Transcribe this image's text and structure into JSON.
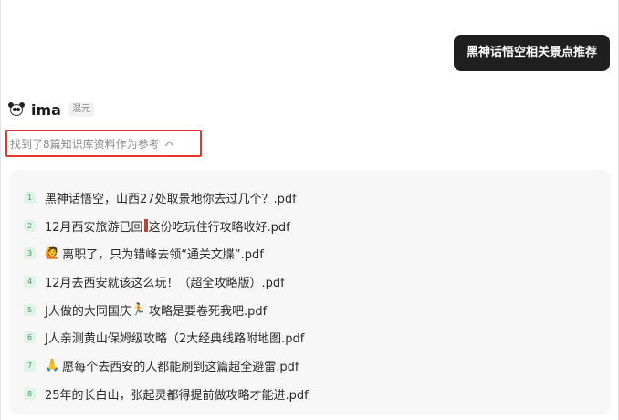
{
  "user_message": "黑神话悟空相关景点推荐",
  "assistant": {
    "avatar_icon": "panda-icon",
    "name": "ima",
    "model_tag": "混元"
  },
  "references": {
    "toggle_label": "找到了8篇知识库资料作为参考",
    "highlight_color": "#e8352b",
    "items": [
      {
        "num": "1",
        "title": "黑神话悟空，山西27处取景地你去过几个？.pdf"
      },
      {
        "num": "2",
        "title_a": "12月西安旅游已回",
        "title_b": "这份吃玩住行攻略收好.pdf"
      },
      {
        "num": "3",
        "icon": "🙋",
        "title": "离职了，只为错峰去领“通关文牒”.pdf"
      },
      {
        "num": "4",
        "title": "12月去西安就该这么玩！（超全攻略版）.pdf"
      },
      {
        "num": "5",
        "title_a": "J人做的大同国庆",
        "icon": "🏃",
        "title_b": "攻略是要卷死我吧.pdf"
      },
      {
        "num": "6",
        "title": "J人亲测黄山保姆级攻略（2大经典线路附地图.pdf"
      },
      {
        "num": "7",
        "icon": "🙏",
        "title": "愿每个去西安的人都能刷到这篇超全避雷.pdf"
      },
      {
        "num": "8",
        "title": "25年的长白山，张起灵都得提前做攻略才能进.pdf"
      }
    ]
  }
}
